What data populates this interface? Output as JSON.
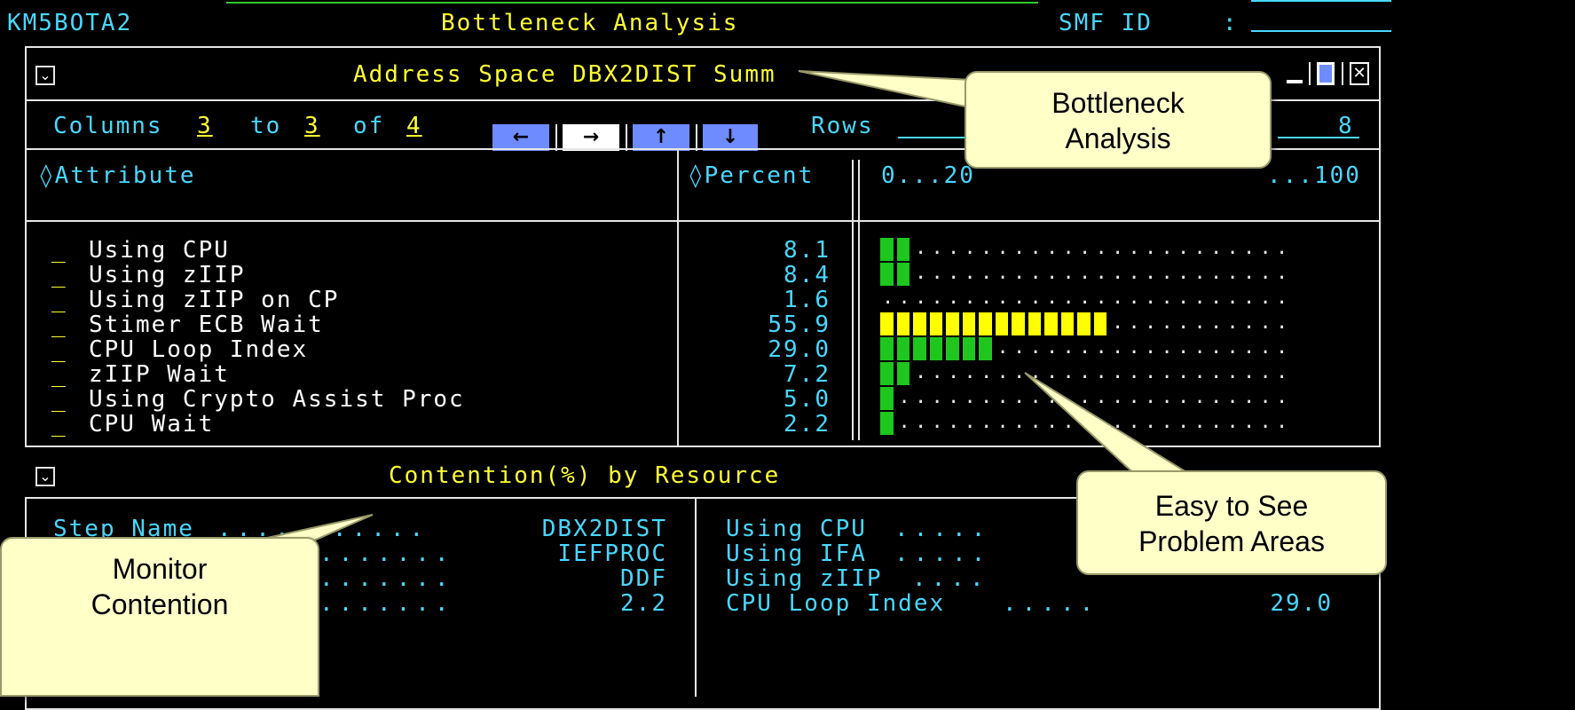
{
  "header": {
    "id": "KM5BOTA2",
    "title": "Bottleneck Analysis",
    "smf_label": "SMF ID",
    "smf_sep": ":"
  },
  "summary_panel": {
    "title": "Address Space DBX2DIST Summ",
    "columns_label": "Columns",
    "col_from": "3",
    "to_word": "to",
    "col_to": "3",
    "of_word": "of",
    "col_total": "4",
    "nav": [
      "←",
      "→",
      "↑",
      "↓"
    ],
    "rows_label": "Rows",
    "rows_total": "8",
    "attr_header": "◊Attribute",
    "percent_header": "◊Percent",
    "scale_left": "0...20",
    "scale_right": "...100",
    "rows": [
      {
        "label": "Using CPU",
        "value": "8.1"
      },
      {
        "label": "Using zIIP",
        "value": "8.4"
      },
      {
        "label": "Using zIIP on CP",
        "value": "1.6"
      },
      {
        "label": "Stimer ECB Wait",
        "value": "55.9"
      },
      {
        "label": "CPU Loop Index",
        "value": "29.0"
      },
      {
        "label": "zIIP Wait",
        "value": "7.2"
      },
      {
        "label": "Using Crypto Assist Proc",
        "value": "5.0"
      },
      {
        "label": "CPU Wait",
        "value": "2.2"
      }
    ],
    "row_select_mark": "_",
    "chart_colors": {
      "normal": "#1ec61e",
      "warning": "#ffff00"
    }
  },
  "contention_panel": {
    "title": "Contention(%) by Resource",
    "left": [
      {
        "label": "Step Name",
        "value": "DBX2DIST"
      },
      {
        "label": "",
        "value": "IEFPROC"
      },
      {
        "label": "",
        "value": "DDF"
      },
      {
        "label": "",
        "value": "2.2"
      }
    ],
    "right": [
      {
        "label": "Using CPU",
        "value": ""
      },
      {
        "label": "Using IFA",
        "value": ""
      },
      {
        "label": "Using zIIP",
        "value": ""
      },
      {
        "label": "CPU Loop Index",
        "value": "29.0"
      }
    ]
  },
  "callouts": {
    "bottleneck": [
      "Bottleneck",
      "Analysis"
    ],
    "problem": [
      "Easy to See",
      "Problem Areas"
    ],
    "monitor": [
      "Monitor",
      "Contention"
    ]
  }
}
